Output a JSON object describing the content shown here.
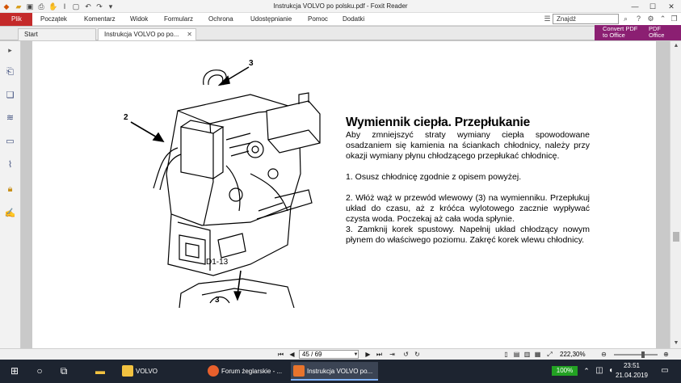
{
  "window": {
    "title": "Instrukcja VOLVO po polsku.pdf - Foxit Reader"
  },
  "menu": {
    "file": "Plik",
    "items": [
      "Początek",
      "Komentarz",
      "Widok",
      "Formularz",
      "Ochrona",
      "Udostępnianie",
      "Pomoc",
      "Dodatki"
    ]
  },
  "search": {
    "placeholder": "Znajdź"
  },
  "tabs": [
    {
      "label": "Start"
    },
    {
      "label": "Instrukcja VOLVO po po..."
    }
  ],
  "banner": {
    "line1": "Convert PDF",
    "line2": "to Office",
    "pdf": "PDF",
    "office": "Office"
  },
  "document": {
    "figure": {
      "label_3_top": "3",
      "label_2": "2",
      "caption": "D1-13",
      "label_3_bottom": "3"
    },
    "heading": "Wymiennik ciepła. Przepłukanie",
    "intro": "Aby zmniejszyć straty wymiany ciepła spowodowane osadzaniem się kamienia na ściankach chłodnicy, należy przy okazji wymiany płynu chłodzącego przepłukać chłodnicę.",
    "step1": "1.     Osusz chłodnicę zgodnie z opisem powyżej.",
    "step2": "2. Włóż wąż w przewód wlewowy (3) na wymienniku. Przepłukuj układ do czasu, aż z króćca wylotowego zacznie wypływać czysta woda. Poczekaj aż cała woda spłynie.",
    "step3": "3. Zamknij korek spustowy. Napełnij układ chłodzący nowym płynem do właściwego poziomu. Zakręć korek wlewu chłodnicy."
  },
  "statusbar": {
    "page_indicator": "45 / 69",
    "zoom": "222,30%"
  },
  "taskbar": {
    "tasks": [
      {
        "label": "VOLVO"
      },
      {
        "label": "Forum żeglarskie - ..."
      },
      {
        "label": "Instrukcja VOLVO po..."
      }
    ],
    "battery": "100%",
    "time": "23:51",
    "date": "21.04.2019"
  },
  "colors": {
    "file_menu": "#c42a2a",
    "banner": "#8b1f72",
    "taskbar": "#1d2430"
  }
}
